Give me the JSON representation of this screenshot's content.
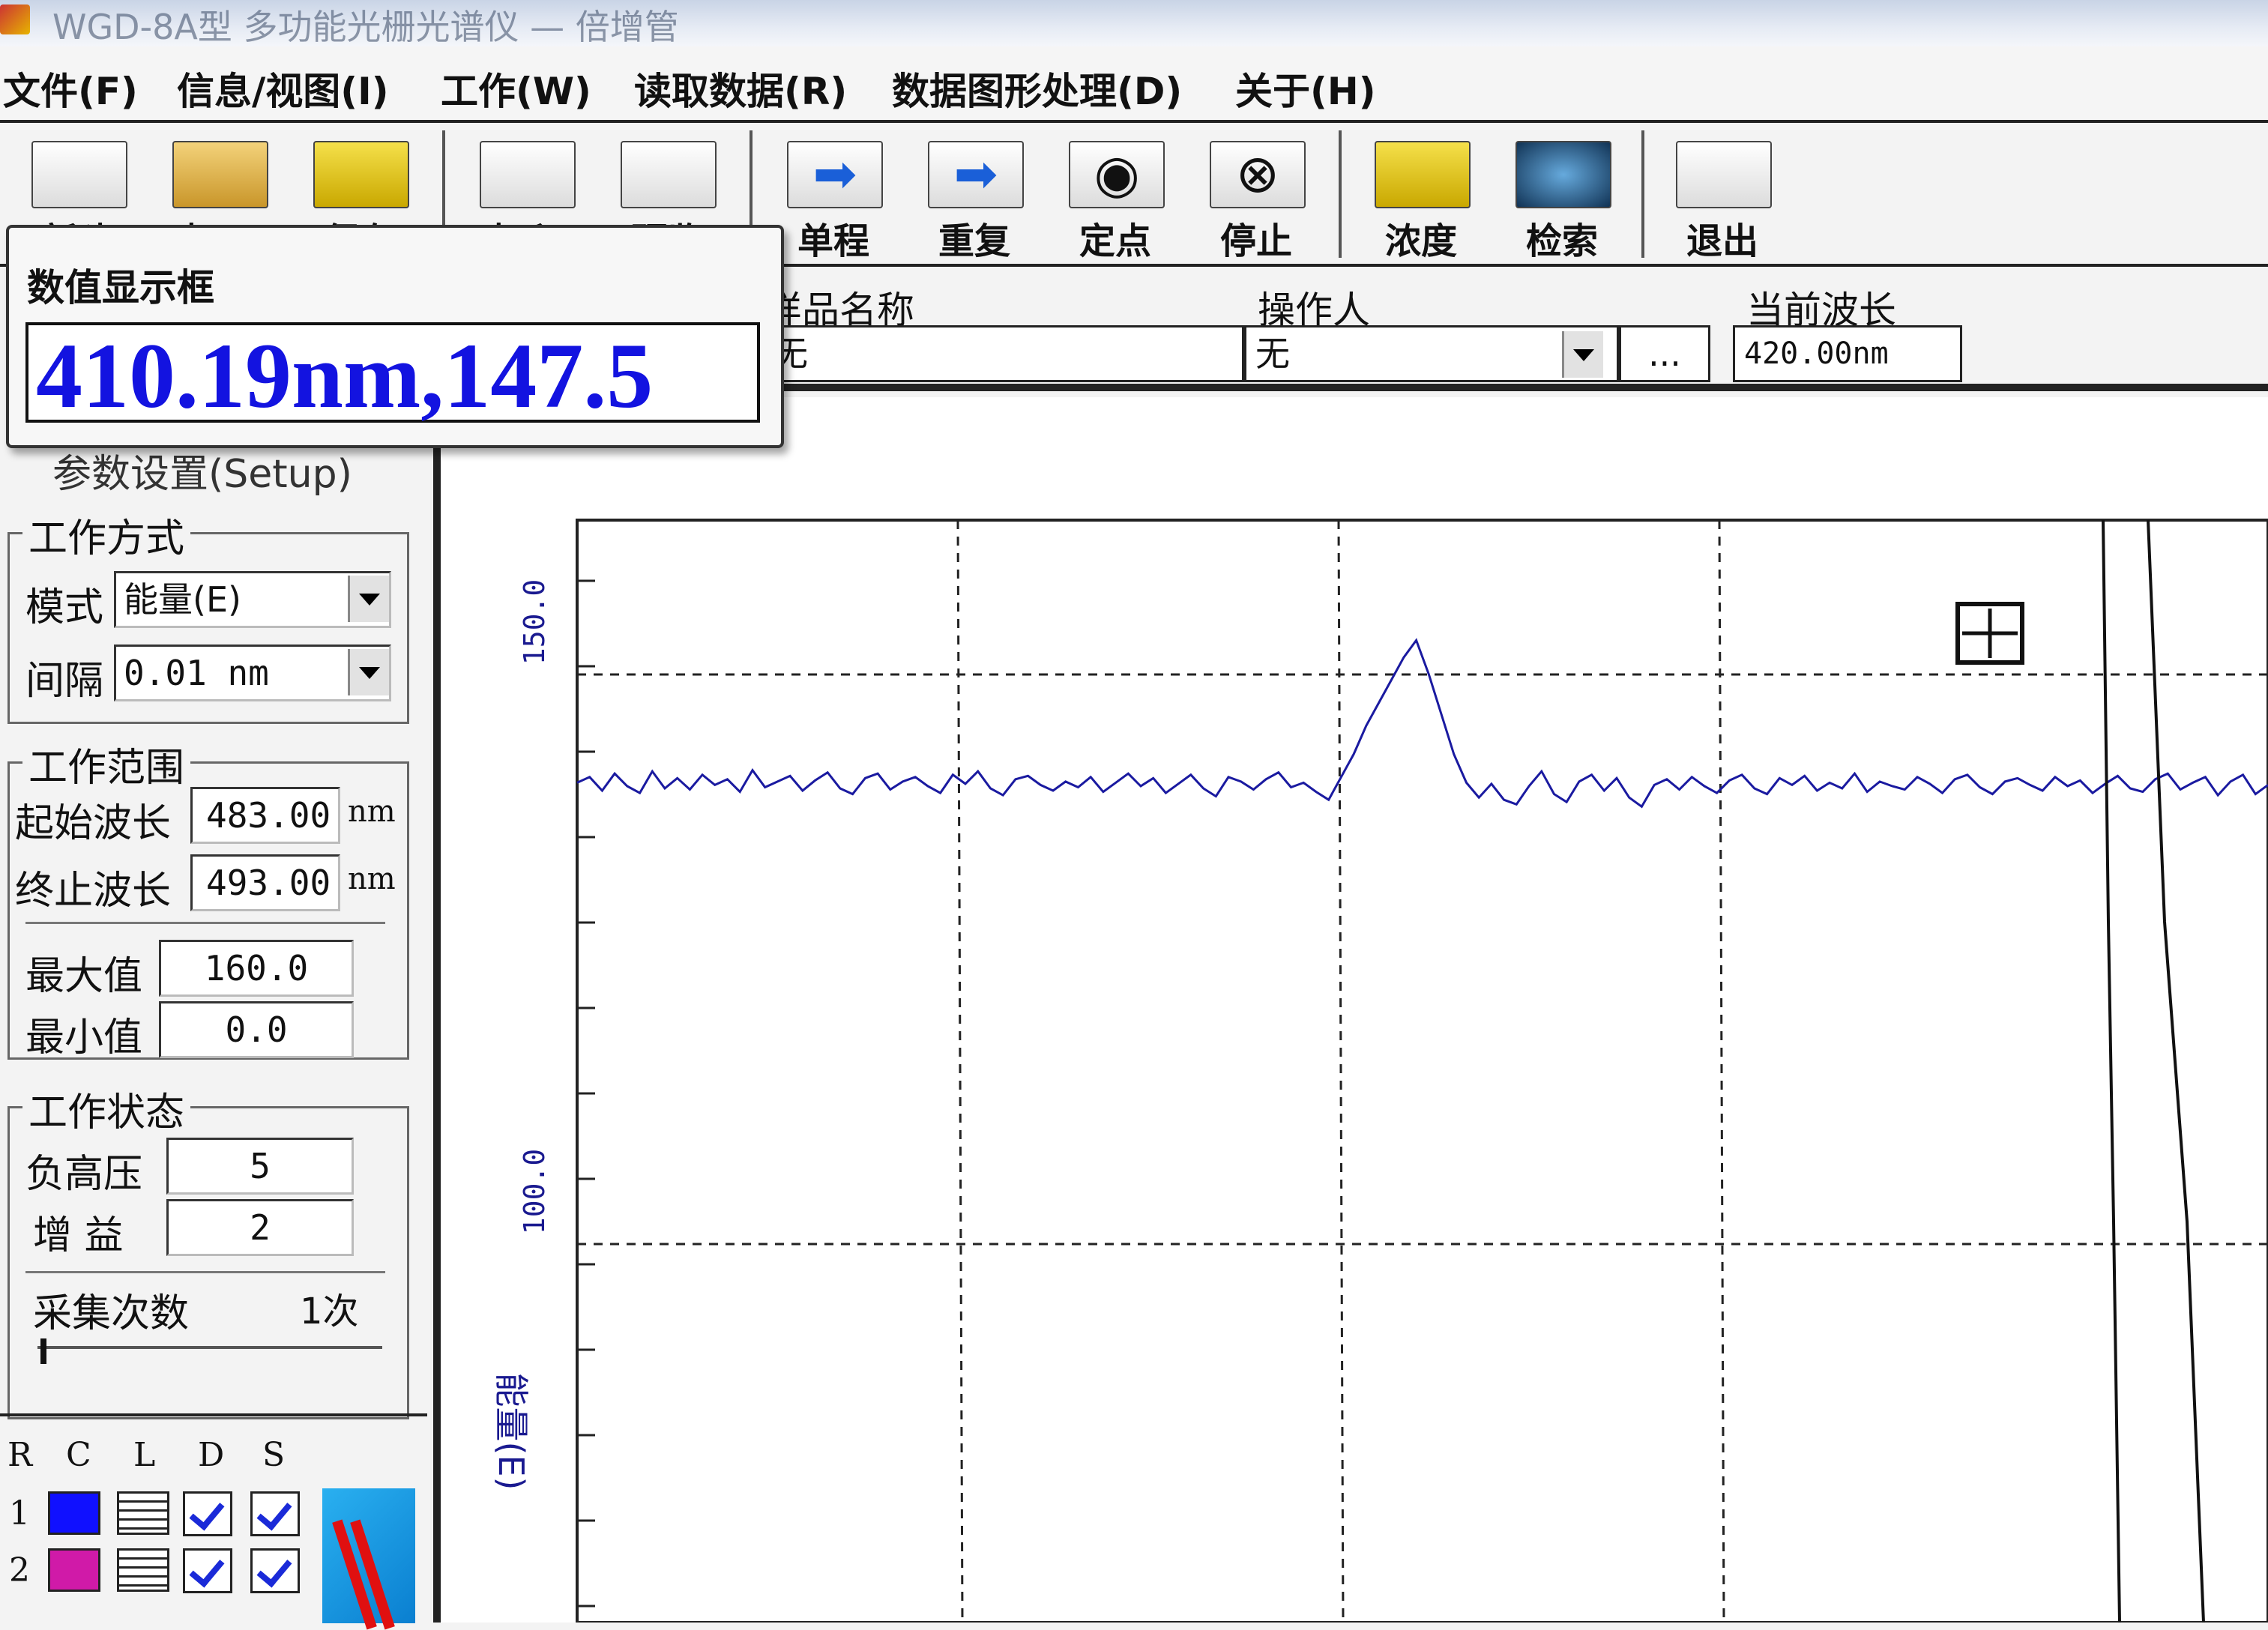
{
  "window": {
    "title": "WGD-8A型 多功能光栅光谱仪 — 倍增管"
  },
  "menu": [
    "文件(F)",
    "信息/视图(I)",
    "工作(W)",
    "读取数据(R)",
    "数据图形处理(D)",
    "关于(H)"
  ],
  "toolbar": {
    "buttons": [
      {
        "label": "新建",
        "icon": "new-file-icon"
      },
      {
        "label": "打开",
        "icon": "open-folder-icon"
      },
      {
        "label": "保存",
        "icon": "floppy-save-icon"
      },
      {
        "label": "打印",
        "icon": "printer-icon"
      },
      {
        "label": "预览",
        "icon": "print-preview-icon"
      },
      {
        "label": "单程",
        "icon": "arrow-right-icon"
      },
      {
        "label": "重复",
        "icon": "arrow-right-repeat-icon"
      },
      {
        "label": "定点",
        "icon": "fixed-point-icon"
      },
      {
        "label": "停止",
        "icon": "stop-icon"
      },
      {
        "label": "浓度",
        "icon": "concentration-icon"
      },
      {
        "label": "检索",
        "icon": "search-globe-icon"
      },
      {
        "label": "退出",
        "icon": "exit-door-icon"
      }
    ]
  },
  "value_panel": {
    "title": "数值显示框",
    "value": "410.19nm,147.5"
  },
  "fields": {
    "sample_label": "样品名称",
    "sample_value": "无",
    "operator_label": "操作人",
    "operator_value": "无",
    "operator_more": "...",
    "wavelength_label": "当前波长",
    "wavelength_value": "420.00nm"
  },
  "settings": {
    "setup_tab": "参数设置(Setup)",
    "mode_group": "工作方式",
    "mode_label": "模式",
    "mode_value": "能量(E)",
    "interval_label": "间隔",
    "interval_value": "0.01  nm",
    "range_group": "工作范围",
    "start_label": "起始波长",
    "start_value": "483.00",
    "start_unit": "nm",
    "end_label": "终止波长",
    "end_value": "493.00",
    "end_unit": "nm",
    "max_label": "最大值",
    "max_value": "160.0",
    "min_label": "最小值",
    "min_value": "0.0",
    "status_group": "工作状态",
    "hv_label": "负高压",
    "hv_value": "5",
    "gain_label": "增    益",
    "gain_value": "2",
    "count_label": "采集次数",
    "count_value": "1次"
  },
  "channels": {
    "headers": [
      "R",
      "C",
      "L",
      "D",
      "S"
    ],
    "rows": [
      {
        "index": "1",
        "color": "#1010ff",
        "d": true,
        "s": true
      },
      {
        "index": "2",
        "color": "#d01aa8",
        "d": true,
        "s": true
      }
    ]
  },
  "chart_data": {
    "type": "line",
    "ylabel": "能量(E)",
    "y_ticks": [
      "150.0",
      "100.0"
    ],
    "grid": "dashed",
    "series_color": "#1a1aa0",
    "series": [
      {
        "values": [
          140.5,
          141.0,
          139.8,
          141.3,
          140.2,
          139.6,
          141.5,
          140.0,
          140.9,
          139.9,
          141.2,
          140.3,
          140.8,
          139.7,
          141.6,
          140.1,
          140.6,
          141.1,
          139.8,
          140.7,
          141.4,
          140.0,
          139.5,
          140.9,
          141.3,
          139.9,
          140.6,
          141.0,
          140.2,
          139.6,
          141.2,
          140.4,
          141.5,
          140.0,
          139.4,
          140.8,
          141.1,
          140.3,
          139.8,
          140.6,
          140.1,
          141.0,
          139.7,
          140.5,
          141.3,
          140.2,
          140.9,
          139.6,
          140.4,
          141.2,
          140.0,
          139.3,
          141.0,
          140.6,
          139.9,
          140.8,
          141.4,
          140.1,
          140.5,
          139.7,
          139.0,
          141.0,
          143.0,
          145.5,
          147.5,
          149.5,
          151.5,
          153.0,
          150.0,
          146.5,
          143.0,
          140.5,
          139.2,
          140.4,
          139.0,
          138.6,
          140.2,
          141.5,
          139.5,
          138.8,
          140.6,
          141.2,
          139.8,
          140.9,
          139.2,
          138.4,
          140.3,
          140.8,
          139.9,
          141.0,
          140.2,
          139.6,
          140.7,
          141.2,
          140.0,
          139.5,
          140.9,
          140.3,
          141.1,
          139.8,
          140.5,
          140.0,
          141.3,
          139.7,
          140.6,
          140.2,
          139.9,
          141.0,
          140.4,
          139.6,
          140.8,
          141.2,
          140.1,
          139.5,
          140.6,
          140.9,
          140.3,
          139.8,
          141.0,
          140.2,
          140.7,
          139.6,
          140.4,
          141.1,
          140.0,
          139.7,
          140.8,
          141.3,
          139.9,
          140.5,
          141.0,
          139.4,
          140.6,
          141.2,
          139.5,
          140.3
        ]
      }
    ]
  }
}
